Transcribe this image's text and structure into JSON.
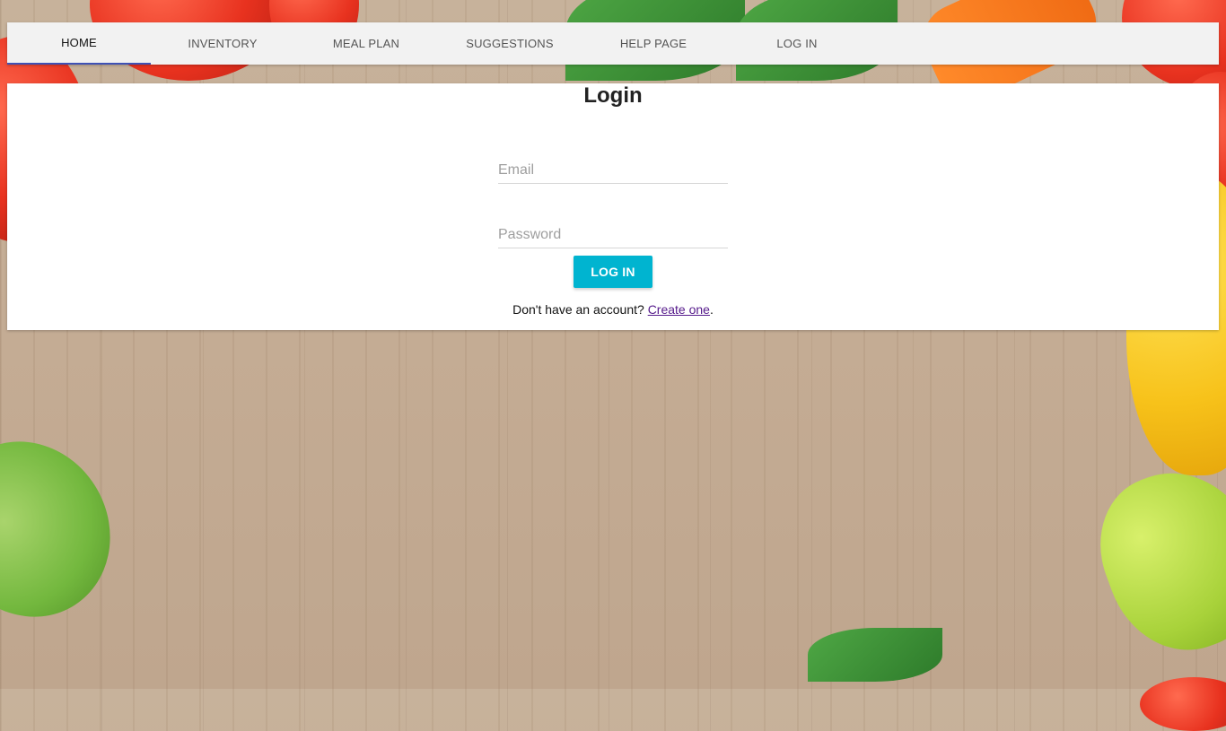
{
  "nav": {
    "items": [
      {
        "label": "HOME"
      },
      {
        "label": "INVENTORY"
      },
      {
        "label": "MEAL PLAN"
      },
      {
        "label": "SUGGESTIONS"
      },
      {
        "label": "HELP PAGE"
      },
      {
        "label": "LOG IN"
      }
    ]
  },
  "login": {
    "title": "Login",
    "email_placeholder": "Email",
    "password_placeholder": "Password",
    "button_label": "LOG IN",
    "signup_prefix": "Don't have an account? ",
    "signup_link": "Create one",
    "signup_suffix": "."
  }
}
